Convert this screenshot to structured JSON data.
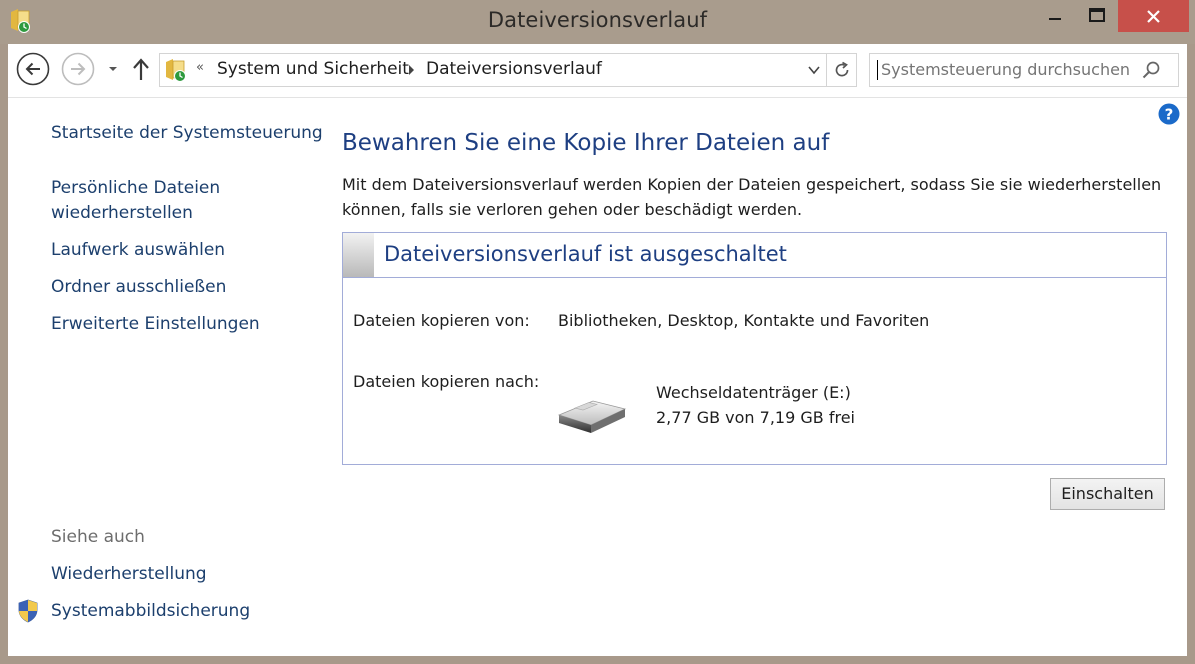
{
  "window": {
    "title": "Dateiversionsverlauf",
    "controls": {
      "minimize": "minimize-icon",
      "maximize": "maximize-icon",
      "close": "close-icon"
    }
  },
  "address_bar": {
    "segments": [
      "System und Sicherheit",
      "Dateiversionsverlauf"
    ],
    "overflow_chevron": "«"
  },
  "search": {
    "placeholder": "Systemsteuerung durchsuchen"
  },
  "sidebar": {
    "home": "Startseite der Systemsteuerung",
    "items": [
      {
        "label": "Persönliche Dateien\nwiederherstellen"
      },
      {
        "label": "Laufwerk auswählen"
      },
      {
        "label": "Ordner ausschließen"
      },
      {
        "label": "Erweiterte Einstellungen"
      }
    ],
    "see_also": {
      "heading": "Siehe auch",
      "items": [
        {
          "label": "Wiederherstellung"
        },
        {
          "label": "Systemabbildsicherung",
          "icon": "uac-shield-icon"
        }
      ]
    }
  },
  "main": {
    "title": "Bewahren Sie eine Kopie Ihrer Dateien auf",
    "description": "Mit dem Dateiversionsverlauf werden Kopien der Dateien gespeichert, sodass Sie sie wiederherstellen können, falls sie verloren gehen oder beschädigt werden.",
    "panel": {
      "status_title": "Dateiversionsverlauf ist ausgeschaltet",
      "copy_from_label": "Dateien kopieren von:",
      "copy_from_value": "Bibliotheken, Desktop, Kontakte und Favoriten",
      "copy_to_label": "Dateien kopieren nach:",
      "drive_name": "Wechseldatenträger (E:)",
      "drive_free": "2,77 GB von 7,19 GB frei"
    },
    "turn_on_button": "Einschalten"
  },
  "colors": {
    "link": "#1c3f6d",
    "heading": "#1e3f82",
    "close_button": "#c7504a",
    "frame": "#a99c8d",
    "panel_border": "#a2acd8"
  }
}
